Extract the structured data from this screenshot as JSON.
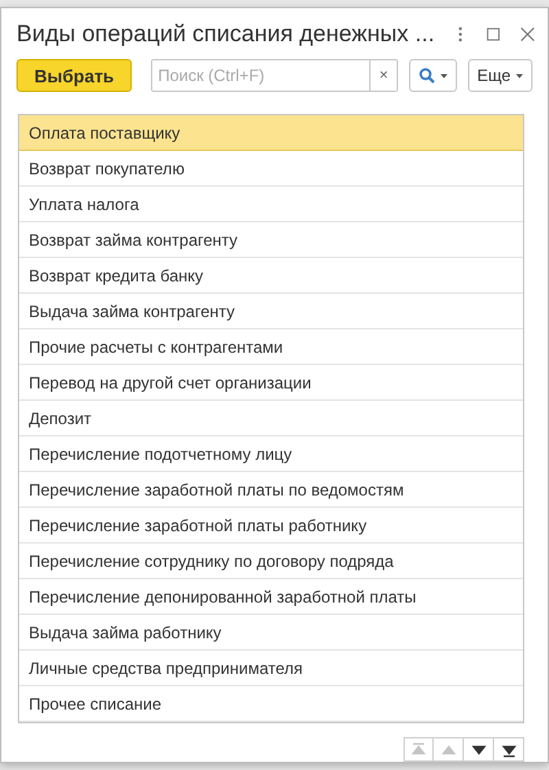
{
  "window": {
    "title": "Виды операций списания денежных ..."
  },
  "toolbar": {
    "select_button": "Выбрать",
    "search": {
      "placeholder": "Поиск (Ctrl+F)"
    },
    "clear_button": "×",
    "more_button": "Еще"
  },
  "list": [
    {
      "label": "Оплата поставщику",
      "selected": true
    },
    {
      "label": "Возврат покупателю",
      "selected": false
    },
    {
      "label": "Уплата налога",
      "selected": false
    },
    {
      "label": "Возврат займа контрагенту",
      "selected": false
    },
    {
      "label": "Возврат кредита банку",
      "selected": false
    },
    {
      "label": "Выдача займа контрагенту",
      "selected": false
    },
    {
      "label": "Прочие расчеты с контрагентами",
      "selected": false
    },
    {
      "label": "Перевод на другой счет организации",
      "selected": false
    },
    {
      "label": "Депозит",
      "selected": false
    },
    {
      "label": "Перечисление подотчетному лицу",
      "selected": false
    },
    {
      "label": "Перечисление заработной платы по ведомостям",
      "selected": false
    },
    {
      "label": "Перечисление заработной платы работнику",
      "selected": false
    },
    {
      "label": "Перечисление сотруднику по договору подряда",
      "selected": false
    },
    {
      "label": "Перечисление депонированной заработной платы",
      "selected": false
    },
    {
      "label": "Выдача займа работнику",
      "selected": false
    },
    {
      "label": "Личные средства предпринимателя",
      "selected": false
    },
    {
      "label": "Прочее списание",
      "selected": false
    }
  ],
  "navigation": [
    {
      "kind": "first",
      "disabled": true
    },
    {
      "kind": "up",
      "disabled": true
    },
    {
      "kind": "down",
      "disabled": false
    },
    {
      "kind": "last",
      "disabled": false
    }
  ]
}
